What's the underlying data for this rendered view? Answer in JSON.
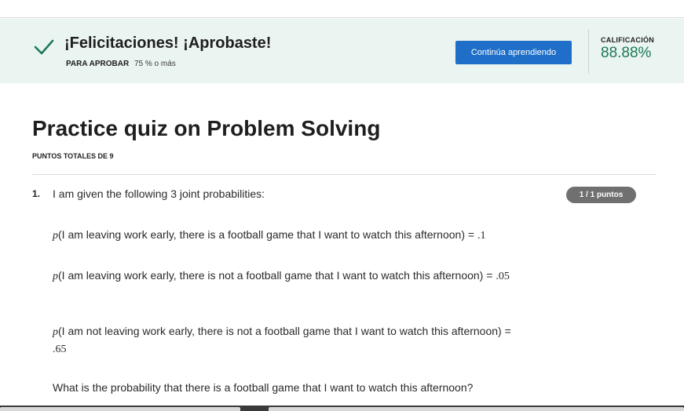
{
  "banner": {
    "title": "¡Felicitaciones! ¡Aprobaste!",
    "pass_label": "PARA APROBAR",
    "pass_value": "75 % o más",
    "continue_label": "Continúa aprendiendo",
    "grade_label": "CALIFICACIÓN",
    "grade_value": "88.88%",
    "accent_color": "#1d7a57",
    "button_color": "#1f6fc8"
  },
  "quiz": {
    "title": "Practice quiz on Problem Solving",
    "total_points": "PUNTOS TOTALES DE 9"
  },
  "question": {
    "number": "1.",
    "points": "1 / 1 puntos",
    "intro": "I am given the following 3 joint probabilities:",
    "p_symbol": "p",
    "line1": "(I am leaving work early, there is a football game that I want to watch this afternoon) = ",
    "line1_value": ".1",
    "line2": "(I am leaving work early, there is not a football game that I want to watch this afternoon) = ",
    "line2_value": ".05",
    "line3": "(I am not leaving work early, there is not a football game that I want to watch this afternoon) = ",
    "line3_value": ".65",
    "prompt": "What is the probability that there is a football game that I want to watch this afternoon?"
  }
}
